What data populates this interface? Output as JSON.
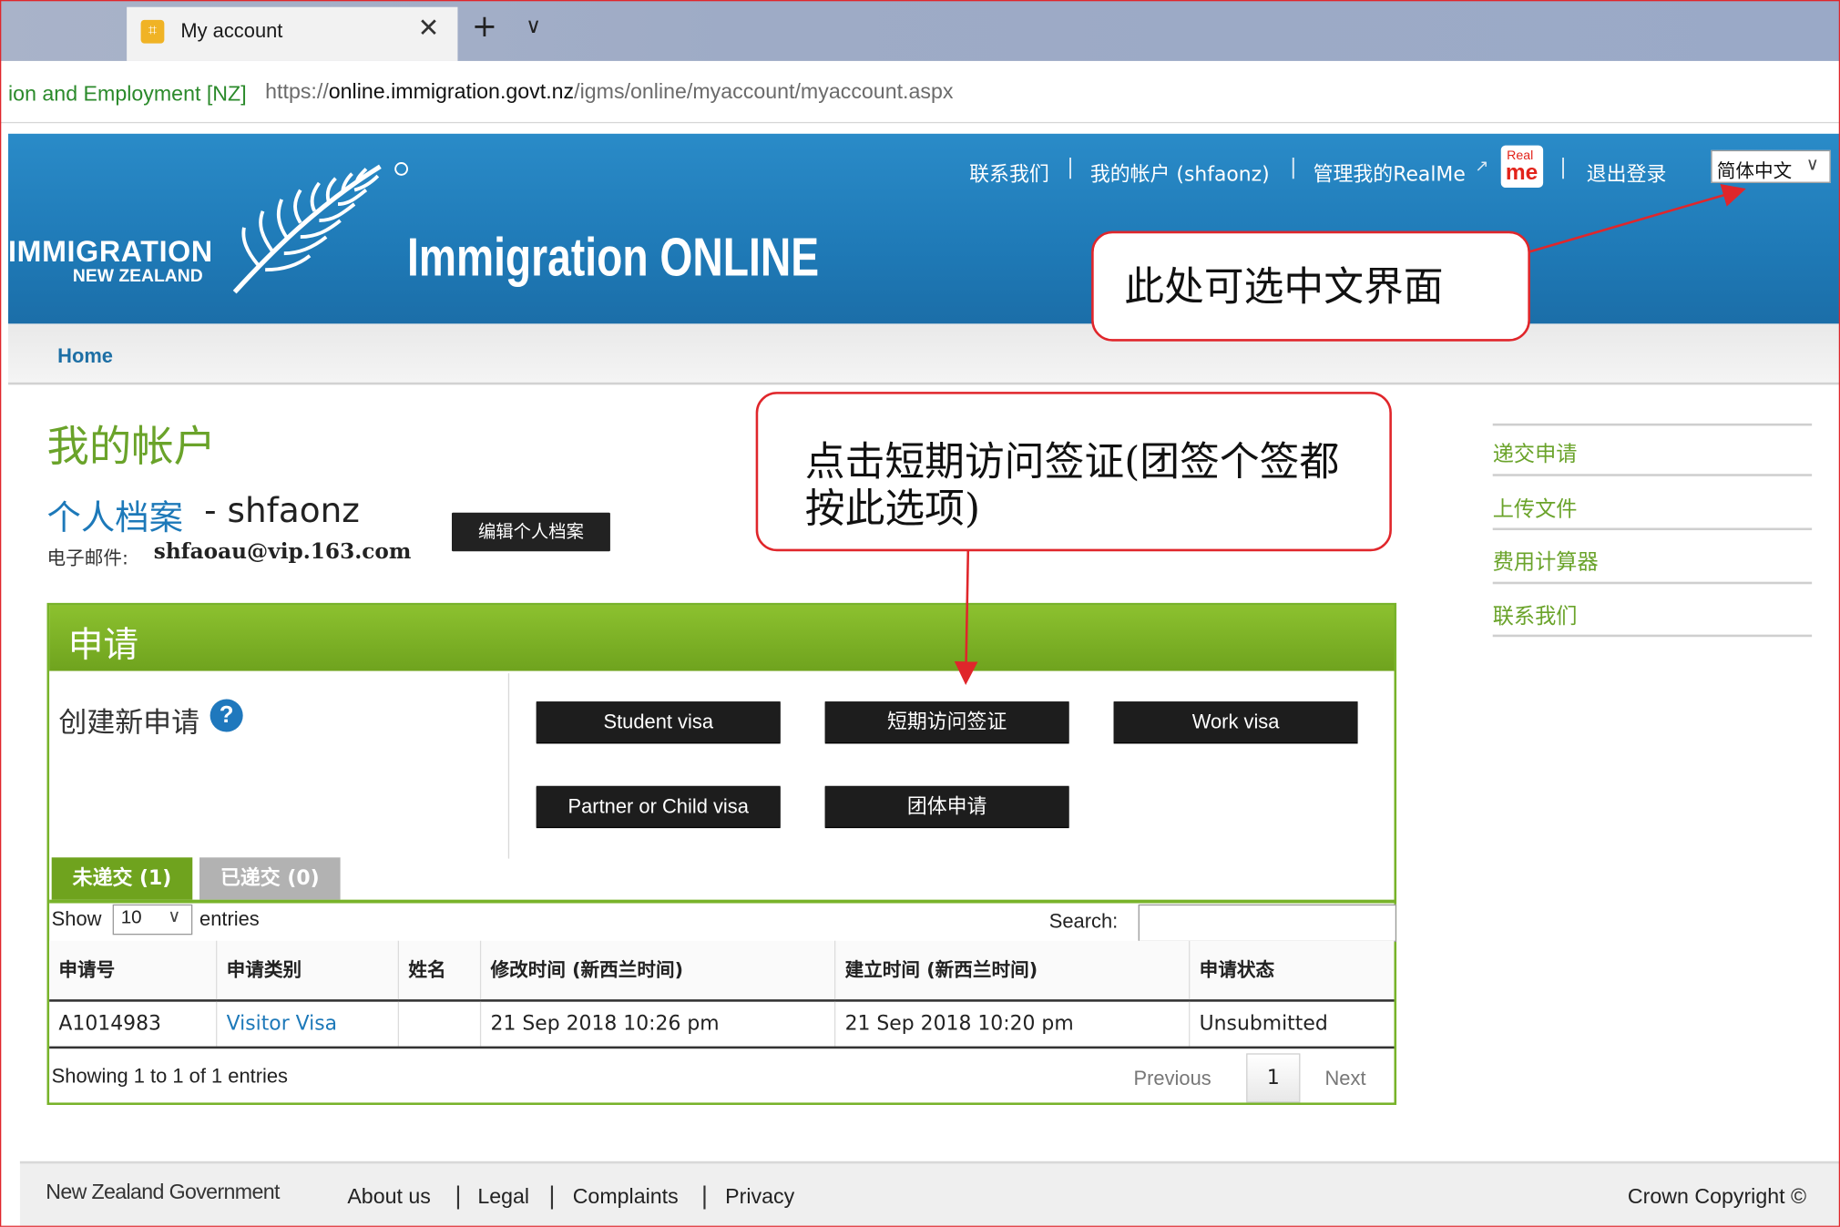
{
  "browser": {
    "tab_title": "My account",
    "tab_close": "✕",
    "new_tab": "+",
    "tab_menu": "∨",
    "site_identity": "ion and Employment [NZ]",
    "url_prefix": "https://",
    "url_domain": "online.immigration.govt.nz",
    "url_path": "/igms/online/myaccount/myaccount.aspx"
  },
  "header": {
    "logo_line1": "IMMIGRATION",
    "logo_line2": "NEW ZEALAND",
    "site_title": "Immigration ONLINE",
    "nav": {
      "contact": "联系我们",
      "my_account": "我的帐户 (shfaonz)",
      "realme_manage": "管理我的RealMe",
      "logout": "退出登录"
    },
    "realme_logo_top": "Real",
    "realme_logo_bottom": "me",
    "language": "简体中文",
    "accent_color": "#1f7ab7"
  },
  "breadcrumb": {
    "home": "Home"
  },
  "main": {
    "page_title": "我的帐户",
    "profile_link": "个人档案",
    "profile_user": " - shfaonz",
    "email_label": "电子邮件:",
    "email_value": "shfaoau@vip.163.com",
    "edit_profile": "编辑个人档案"
  },
  "applications": {
    "title": "申请",
    "create_label": "创建新申请",
    "help": "?",
    "buttons": {
      "student": "Student visa",
      "visitor": "短期访问签证",
      "work": "Work visa",
      "partner": "Partner or Child visa",
      "group": "团体申请"
    },
    "tabs": {
      "unsubmitted": "未递交 (1)",
      "submitted": "已递交 (0)"
    },
    "show_label": "Show",
    "show_value": "10",
    "entries_label": "entries",
    "search_label": "Search:",
    "search_value": "",
    "columns": [
      "申请号",
      "申请类别",
      "姓名",
      "修改时间 (新西兰时间)",
      "建立时间 (新西兰时间)",
      "申请状态"
    ],
    "rows": [
      [
        "A1014983",
        "Visitor Visa",
        "",
        "21 Sep 2018 10:26 pm",
        "21 Sep 2018 10:20 pm",
        "Unsubmitted"
      ]
    ],
    "showing": "Showing 1 to 1 of 1 entries",
    "previous": "Previous",
    "page": "1",
    "next": "Next",
    "accent_color": "#6fa31e"
  },
  "sidebar": {
    "items": [
      "递交申请",
      "上传文件",
      "费用计算器",
      "联系我们"
    ]
  },
  "footer": {
    "gov_logo": "New Zealand Government",
    "links": [
      "About us",
      "Legal",
      "Complaints",
      "Privacy"
    ],
    "copyright": "Crown Copyright ©"
  },
  "annotations": {
    "language_note": "此处可选中文界面",
    "visa_note": "点击短期访问签证(团签个签都按此选项)",
    "color": "#e0262b"
  }
}
